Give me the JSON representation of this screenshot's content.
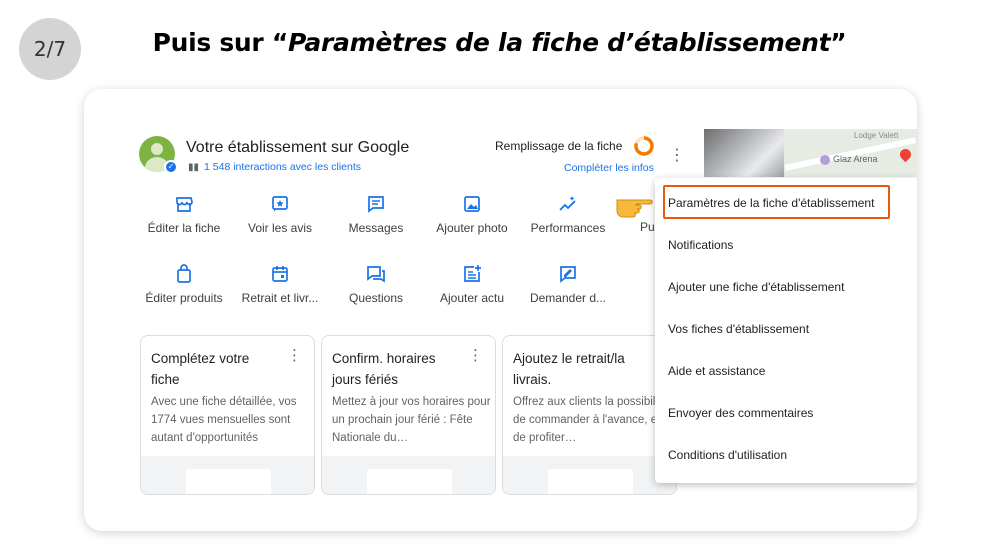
{
  "slide": {
    "step": "2/7",
    "title_prefix": "Puis sur “",
    "title_emph": "Paramètres de la fiche d’établissement",
    "title_suffix": "”"
  },
  "business": {
    "name": "Votre établissement sur Google",
    "stats": "1 548 interactions avec les clients",
    "fill_label": "Remplissage de la fiche",
    "fill_link": "Compléter les infos",
    "fill_progress": 0.8,
    "accent_color": "#1a73e8",
    "progress_color": "#f57c00"
  },
  "map": {
    "poi_label": "Glaz Arena",
    "street_label": "Lodge Valett"
  },
  "actions_row1": [
    {
      "label": "Éditer la fiche",
      "icon": "storefront-icon"
    },
    {
      "label": "Voir les avis",
      "icon": "star-review-icon"
    },
    {
      "label": "Messages",
      "icon": "message-icon"
    },
    {
      "label": "Ajouter photo",
      "icon": "photo-icon"
    },
    {
      "label": "Performances",
      "icon": "sparkle-chart-icon"
    },
    {
      "label": "Pu",
      "icon": "post-icon"
    }
  ],
  "actions_row2": [
    {
      "label": "Éditer produits",
      "icon": "shopping-bag-icon"
    },
    {
      "label": "Retrait et livr...",
      "icon": "calendar-icon"
    },
    {
      "label": "Questions",
      "icon": "questions-icon"
    },
    {
      "label": "Ajouter actu",
      "icon": "post-add-icon"
    },
    {
      "label": "Demander d...",
      "icon": "request-review-icon"
    }
  ],
  "cards": [
    {
      "title": "Complétez votre fiche",
      "desc": "Avec une fiche détaillée, vos 1774 vues mensuelles sont autant d'opportunités"
    },
    {
      "title": "Confirm. horaires jours fériés",
      "desc": "Mettez à jour vos horaires pour un prochain jour férié : Fête Nationale du…"
    },
    {
      "title": "Ajoutez le retrait/la livrais.",
      "desc": "Offrez aux clients la possibilité de commander à l'avance, et de profiter…"
    }
  ],
  "menu": [
    "Paramètres de la fiche d'établissement",
    "Notifications",
    "Ajouter une fiche d'établissement",
    "Vos fiches d'établissement",
    "Aide et assistance",
    "Envoyer des commentaires",
    "Conditions d'utilisation"
  ],
  "highlight_color": "#e8590c"
}
